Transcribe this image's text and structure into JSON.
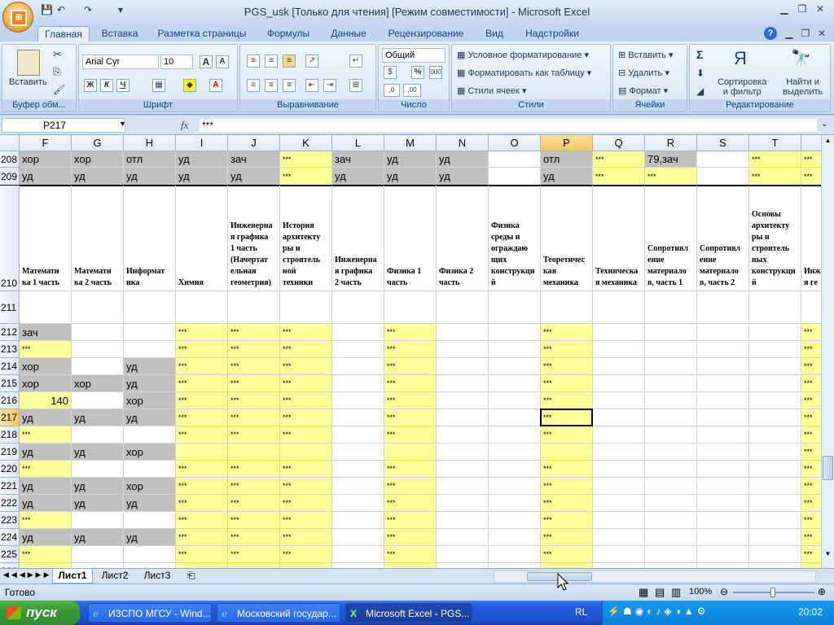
{
  "window": {
    "title": "PGS_usk  [Только для чтения]  [Режим совместимости] - Microsoft Excel",
    "min_btn": "▁",
    "max_btn": "❐",
    "close_btn": "✕"
  },
  "qat": {
    "save": "💾",
    "undo": "↶",
    "redo": "↷",
    "customize": "▾"
  },
  "tabs": [
    "Главная",
    "Вставка",
    "Разметка страницы",
    "Формулы",
    "Данные",
    "Рецензирование",
    "Вид",
    "Надстройки"
  ],
  "ribbon": {
    "clipboard": {
      "label": "Буфер обм...",
      "paste": "Вставить"
    },
    "font": {
      "label": "Шрифт",
      "name": "Arial Cyr",
      "size": "10",
      "grow": "A",
      "shrink": "A",
      "bold": "Ж",
      "italic": "К",
      "underline": "Ч"
    },
    "alignment": {
      "label": "Выравнивание"
    },
    "number": {
      "label": "Число",
      "format": "Общий",
      "percent": "%",
      "thousands": "000",
      "inc": ",0",
      "dec": ",00"
    },
    "styles": {
      "label": "Стили",
      "conditional": "Условное форматирование",
      "table": "Форматировать как таблицу",
      "cell_styles": "Стили ячеек"
    },
    "cells": {
      "label": "Ячейки",
      "insert": "Вставить",
      "delete": "Удалить",
      "format": "Формат"
    },
    "editing": {
      "label": "Редактирование",
      "sort": "Сортировка\nи фильтр",
      "find": "Найти и\nвыделить",
      "sigma": "Σ"
    }
  },
  "formula_bar": {
    "name_box": "P217",
    "fx": "fx",
    "value": "***"
  },
  "columns": [
    "F",
    "G",
    "H",
    "I",
    "J",
    "K",
    "L",
    "M",
    "N",
    "O",
    "P",
    "Q",
    "R",
    "S",
    "T",
    ""
  ],
  "selected_col": "P",
  "rows": {
    "208": [
      "хор",
      "хор",
      "отл",
      "уд",
      "зач",
      "***",
      "зач",
      "уд",
      "уд",
      "",
      "отл",
      "***",
      "79,зач",
      "",
      "***",
      "***"
    ],
    "209": [
      "уд",
      "уд",
      "уд",
      "уд",
      "уд",
      "***",
      "уд",
      "уд",
      "уд",
      "",
      "уд",
      "***",
      "***",
      "",
      "***",
      "***"
    ],
    "210": [
      "Математи\nка 1 часть",
      "Математи\nка 2 часть",
      "Информат\nика",
      "Химия",
      "Инженерна\nя графика\n1 часть\n(Начертат\nельная\nгеометрия)",
      "История\nархитекту\nры и\nстроитель\nной\nтехники",
      "Инженерна\nя графика\n2 часть",
      "Физика 1\nчасть",
      "Физика 2\nчасть",
      "Физика\nсреды и\nограждаю\nщих\nконструкци\nй",
      "Теоретичес\nкая\nмеханика",
      "Техническа\nя механика",
      "Сопротивл\nение\nматериало\nв, часть 1",
      "Сопротивл\nение\nматериало\nв, часть 2",
      "Основы\nархитекту\nры и\nстроитель\nных\nконструкци\nй",
      "Инж\nя ге"
    ],
    "211": [
      "",
      "",
      "",
      "",
      "",
      "",
      "",
      "",
      "",
      "",
      "",
      "",
      "",
      "",
      "",
      ""
    ],
    "212": [
      "зач",
      "",
      "",
      "***",
      "***",
      "***",
      "",
      "***",
      "",
      "",
      "***",
      "",
      "",
      "",
      "",
      "***"
    ],
    "213": [
      "***",
      "",
      "",
      "***",
      "***",
      "***",
      "",
      "***",
      "",
      "",
      "***",
      "",
      "",
      "",
      "",
      "***"
    ],
    "214": [
      "хор",
      "",
      "уд",
      "***",
      "***",
      "***",
      "",
      "***",
      "",
      "",
      "***",
      "",
      "",
      "",
      "",
      "***"
    ],
    "215": [
      "хор",
      "хор",
      "уд",
      "***",
      "***",
      "***",
      "",
      "***",
      "",
      "",
      "***",
      "",
      "",
      "",
      "",
      "***"
    ],
    "216": [
      "140",
      "",
      "хор",
      "***",
      "***",
      "***",
      "",
      "***",
      "",
      "",
      "***",
      "",
      "",
      "",
      "",
      "***"
    ],
    "217": [
      "уд",
      "уд",
      "уд",
      "***",
      "***",
      "***",
      "",
      "***",
      "",
      "",
      "***",
      "",
      "",
      "",
      "",
      "***"
    ],
    "218": [
      "***",
      "",
      "",
      "***",
      "***",
      "***",
      "",
      "***",
      "",
      "",
      "***",
      "",
      "",
      "",
      "",
      "***"
    ],
    "219": [
      "уд",
      "уд",
      "хор",
      "",
      "",
      "",
      "",
      "",
      "",
      "",
      "",
      "",
      "",
      "",
      "",
      "***"
    ],
    "220": [
      "***",
      "",
      "",
      "***",
      "***",
      "***",
      "",
      "***",
      "",
      "",
      "***",
      "",
      "",
      "",
      "",
      "***"
    ],
    "221": [
      "уд",
      "уд",
      "хор",
      "***",
      "***",
      "***",
      "",
      "***",
      "",
      "",
      "***",
      "",
      "",
      "",
      "",
      "***"
    ],
    "222": [
      "уд",
      "уд",
      "уд",
      "***",
      "***",
      "***",
      "",
      "***",
      "",
      "",
      "***",
      "",
      "",
      "",
      "",
      "***"
    ],
    "223": [
      "***",
      "",
      "",
      "***",
      "***",
      "***",
      "",
      "***",
      "",
      "",
      "***",
      "",
      "",
      "",
      "",
      "***"
    ],
    "224": [
      "уд",
      "уд",
      "уд",
      "***",
      "***",
      "***",
      "",
      "***",
      "",
      "",
      "***",
      "",
      "",
      "",
      "",
      "***"
    ],
    "225": [
      "***",
      "",
      "",
      "***",
      "***",
      "***",
      "",
      "***",
      "",
      "",
      "***",
      "",
      "",
      "",
      "",
      "***"
    ],
    "226": [
      "***",
      "",
      "",
      "***",
      "***",
      "***",
      "",
      "***",
      "",
      "",
      "***",
      "",
      "",
      "",
      "",
      "***"
    ]
  },
  "sheets": [
    "Лист1",
    "Лист2",
    "Лист3"
  ],
  "status": {
    "ready": "Готово",
    "zoom": "100%"
  },
  "taskbar": {
    "start": "пуск",
    "tasks": [
      "ИЗСПО МГСУ - Wind...",
      "Московский государ...",
      "Microsoft Excel - PGS..."
    ],
    "lang": "RL",
    "clock": "20:02"
  }
}
